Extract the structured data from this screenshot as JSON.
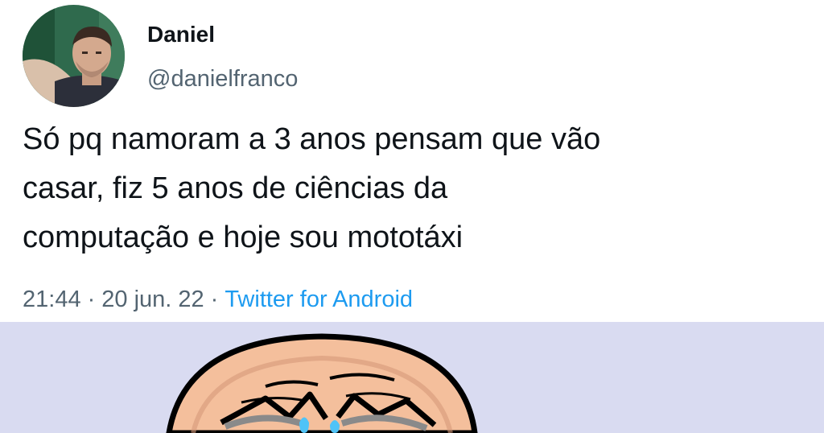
{
  "author": {
    "name": "Daniel",
    "handle": "@danielfranco",
    "avatar_icon": "profile-photo"
  },
  "tweet": {
    "lines": [
      "Só pq namoram a 3 anos pensam que vão",
      "casar, fiz 5 anos de ciências da",
      "computação e hoje sou mototáxi"
    ]
  },
  "meta": {
    "time": "21:44",
    "separator": "·",
    "date": "20 jun. 22",
    "source": "Twitter for Android"
  },
  "meme": {
    "icon": "crying-rage-face",
    "background_color": "#d9dbf1"
  },
  "colors": {
    "text": "#0f1419",
    "secondary": "#536471",
    "link": "#1d9bf0"
  }
}
